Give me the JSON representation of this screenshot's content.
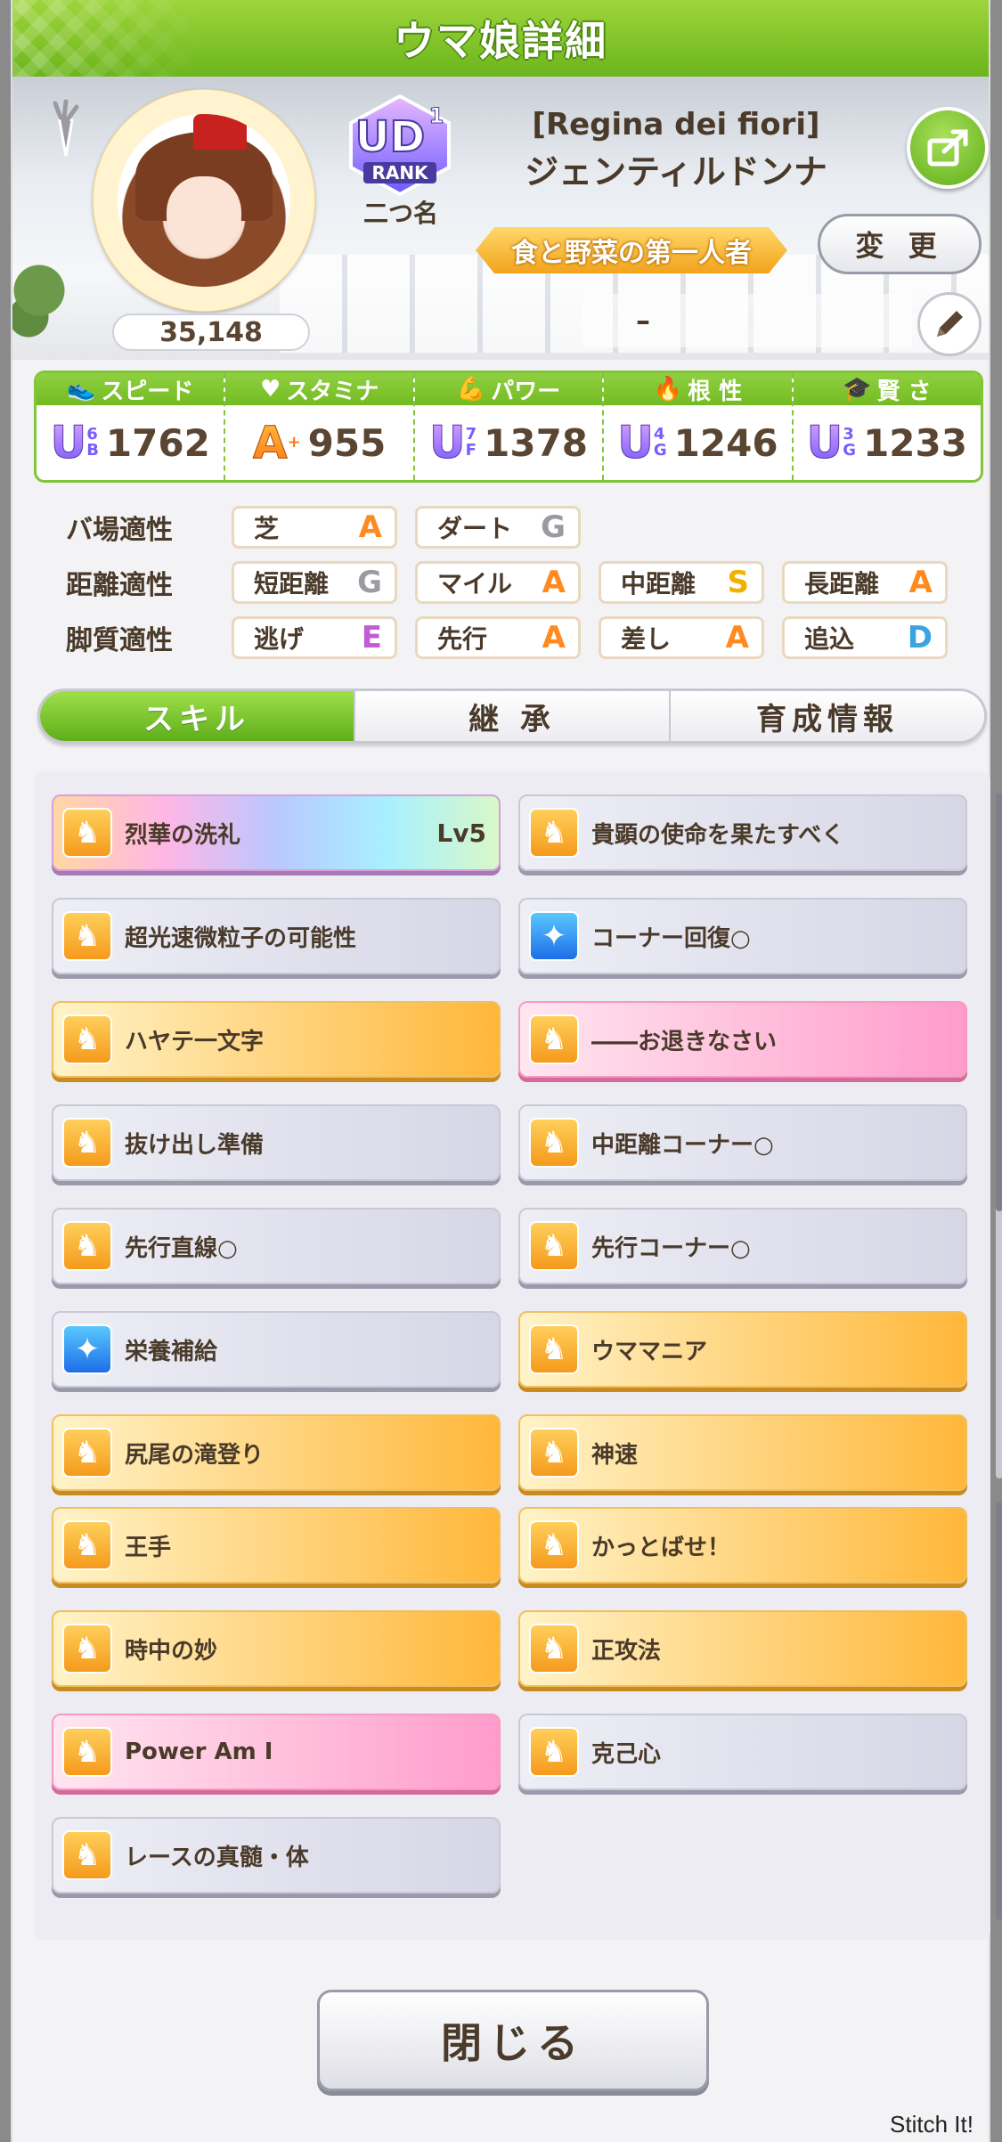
{
  "window": {
    "title": "ウマ娘詳細"
  },
  "profile": {
    "fans": "35,148",
    "rank_label": "RANK",
    "rank_grade": "UD",
    "rank_sub": "1",
    "nickname_label": "二つ名",
    "epithet": "[Regina dei fiori]",
    "horse_name": "ジェンティルドンナ",
    "title_ribbon": "食と野菜の第一人者",
    "change_label": "変 更",
    "stand_text": "–"
  },
  "stats": [
    {
      "label": "スピード",
      "icon": "shoe-icon",
      "grade": "U",
      "grade_sub_top": "6",
      "grade_sub_bottom": "B",
      "value": "1762"
    },
    {
      "label": "スタミナ",
      "icon": "heart-icon",
      "grade": "A",
      "grade_sub_top": "+",
      "grade_sub_bottom": "",
      "value": "955"
    },
    {
      "label": "パワー",
      "icon": "arm-icon",
      "grade": "U",
      "grade_sub_top": "7",
      "grade_sub_bottom": "F",
      "value": "1378"
    },
    {
      "label": "根 性",
      "icon": "flame-icon",
      "grade": "U",
      "grade_sub_top": "4",
      "grade_sub_bottom": "G",
      "value": "1246"
    },
    {
      "label": "賢 さ",
      "icon": "graduation-cap-icon",
      "grade": "U",
      "grade_sub_top": "3",
      "grade_sub_bottom": "G",
      "value": "1233"
    }
  ],
  "aptitudes": {
    "track": {
      "label": "バ場適性",
      "items": [
        {
          "name": "芝",
          "grade": "A"
        },
        {
          "name": "ダート",
          "grade": "G"
        }
      ]
    },
    "distance": {
      "label": "距離適性",
      "items": [
        {
          "name": "短距離",
          "grade": "G"
        },
        {
          "name": "マイル",
          "grade": "A"
        },
        {
          "name": "中距離",
          "grade": "S"
        },
        {
          "name": "長距離",
          "grade": "A"
        }
      ]
    },
    "style": {
      "label": "脚質適性",
      "items": [
        {
          "name": "逃げ",
          "grade": "E"
        },
        {
          "name": "先行",
          "grade": "A"
        },
        {
          "name": "差し",
          "grade": "A"
        },
        {
          "name": "追込",
          "grade": "D"
        }
      ]
    }
  },
  "tabs": [
    {
      "label": "スキル",
      "active": true
    },
    {
      "label": "継 承",
      "active": false
    },
    {
      "label": "育成情報",
      "active": false
    }
  ],
  "skills": [
    {
      "name": "烈華の洗礼",
      "level": "Lv5",
      "style": "rainbow",
      "icon": "horse-icon"
    },
    {
      "name": "貴顕の使命を果たすべく",
      "level": "",
      "style": "normal",
      "icon": "horse-icon"
    },
    {
      "name": "超光速微粒子の可能性",
      "level": "",
      "style": "normal",
      "icon": "horse-icon"
    },
    {
      "name": "コーナー回復○",
      "level": "",
      "style": "normal",
      "icon": "sparkle-icon"
    },
    {
      "name": "ハヤテ一文字",
      "level": "",
      "style": "gold",
      "icon": "horse-icon"
    },
    {
      "name": "――お退きなさい",
      "level": "",
      "style": "pink",
      "icon": "horse-icon"
    },
    {
      "name": "抜け出し準備",
      "level": "",
      "style": "normal",
      "icon": "horse-icon"
    },
    {
      "name": "中距離コーナー○",
      "level": "",
      "style": "normal",
      "icon": "horse-icon"
    },
    {
      "name": "先行直線○",
      "level": "",
      "style": "normal",
      "icon": "horse-icon"
    },
    {
      "name": "先行コーナー○",
      "level": "",
      "style": "normal",
      "icon": "horse-icon"
    },
    {
      "name": "栄養補給",
      "level": "",
      "style": "normal",
      "icon": "sparkle-icon"
    },
    {
      "name": "ウママニア",
      "level": "",
      "style": "gold",
      "icon": "horse-icon"
    },
    {
      "name": "尻尾の滝登り",
      "level": "",
      "style": "gold",
      "icon": "horse-icon"
    },
    {
      "name": "神速",
      "level": "",
      "style": "gold",
      "icon": "horse-icon"
    },
    {
      "name": "王手",
      "level": "",
      "style": "gold",
      "icon": "horse-icon"
    },
    {
      "name": "かっとばせ！",
      "level": "",
      "style": "gold",
      "icon": "horse-icon"
    },
    {
      "name": "時中の妙",
      "level": "",
      "style": "gold",
      "icon": "horse-icon"
    },
    {
      "name": "正攻法",
      "level": "",
      "style": "gold",
      "icon": "horse-icon"
    },
    {
      "name": "Power Am I",
      "level": "",
      "style": "pink",
      "icon": "horse-icon"
    },
    {
      "name": "克己心",
      "level": "",
      "style": "normal",
      "icon": "horse-icon"
    },
    {
      "name": "レースの真髄・体",
      "level": "",
      "style": "normal",
      "icon": "horse-icon"
    }
  ],
  "footer": {
    "close_label": "閉じる",
    "watermark": "Stitch It!"
  }
}
